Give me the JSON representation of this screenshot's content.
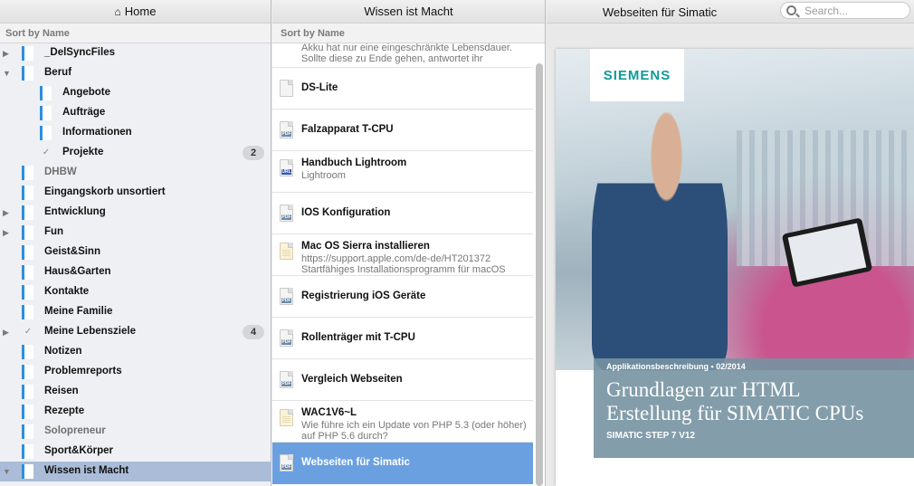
{
  "left": {
    "header": "Home",
    "sort": "Sort by Name",
    "items": [
      {
        "label": "_DelSyncFiles",
        "indent": 0,
        "disclosure": "right",
        "dim": false,
        "badge": "",
        "check": false,
        "selected": false
      },
      {
        "label": "Beruf",
        "indent": 0,
        "disclosure": "down",
        "dim": false,
        "badge": "",
        "check": false,
        "selected": false
      },
      {
        "label": "Angebote",
        "indent": 1,
        "disclosure": "",
        "dim": false,
        "badge": "",
        "check": false,
        "selected": false
      },
      {
        "label": "Aufträge",
        "indent": 1,
        "disclosure": "",
        "dim": false,
        "badge": "",
        "check": false,
        "selected": false
      },
      {
        "label": "Informationen",
        "indent": 1,
        "disclosure": "",
        "dim": false,
        "badge": "",
        "check": false,
        "selected": false
      },
      {
        "label": "Projekte",
        "indent": 1,
        "disclosure": "",
        "dim": false,
        "badge": "2",
        "check": true,
        "selected": false
      },
      {
        "label": "DHBW",
        "indent": 0,
        "disclosure": "",
        "dim": true,
        "badge": "",
        "check": false,
        "selected": false
      },
      {
        "label": "Eingangskorb unsortiert",
        "indent": 0,
        "disclosure": "",
        "dim": false,
        "badge": "",
        "check": false,
        "selected": false
      },
      {
        "label": "Entwicklung",
        "indent": 0,
        "disclosure": "right",
        "dim": false,
        "badge": "",
        "check": false,
        "selected": false
      },
      {
        "label": "Fun",
        "indent": 0,
        "disclosure": "right",
        "dim": false,
        "badge": "",
        "check": false,
        "selected": false
      },
      {
        "label": "Geist&Sinn",
        "indent": 0,
        "disclosure": "",
        "dim": false,
        "badge": "",
        "check": false,
        "selected": false
      },
      {
        "label": "Haus&Garten",
        "indent": 0,
        "disclosure": "",
        "dim": false,
        "badge": "",
        "check": false,
        "selected": false
      },
      {
        "label": "Kontakte",
        "indent": 0,
        "disclosure": "",
        "dim": false,
        "badge": "",
        "check": false,
        "selected": false
      },
      {
        "label": "Meine Familie",
        "indent": 0,
        "disclosure": "",
        "dim": false,
        "badge": "",
        "check": false,
        "selected": false
      },
      {
        "label": "Meine Lebensziele",
        "indent": 0,
        "disclosure": "right",
        "dim": false,
        "badge": "4",
        "check": true,
        "selected": false
      },
      {
        "label": "Notizen",
        "indent": 0,
        "disclosure": "",
        "dim": false,
        "badge": "",
        "check": false,
        "selected": false
      },
      {
        "label": "Problemreports",
        "indent": 0,
        "disclosure": "",
        "dim": false,
        "badge": "",
        "check": false,
        "selected": false
      },
      {
        "label": "Reisen",
        "indent": 0,
        "disclosure": "",
        "dim": false,
        "badge": "",
        "check": false,
        "selected": false
      },
      {
        "label": "Rezepte",
        "indent": 0,
        "disclosure": "",
        "dim": false,
        "badge": "",
        "check": false,
        "selected": false
      },
      {
        "label": "Solopreneur",
        "indent": 0,
        "disclosure": "",
        "dim": true,
        "badge": "",
        "check": false,
        "selected": false
      },
      {
        "label": "Sport&Körper",
        "indent": 0,
        "disclosure": "",
        "dim": false,
        "badge": "",
        "check": false,
        "selected": false
      },
      {
        "label": "Wissen ist Macht",
        "indent": 0,
        "disclosure": "down",
        "dim": false,
        "badge": "",
        "check": false,
        "selected": true
      }
    ]
  },
  "middle": {
    "header": "Wissen ist Macht",
    "sort": "Sort by Name",
    "items": [
      {
        "title": "",
        "sub": [
          "Akku hat nur eine eingeschränkte Lebensdauer.",
          "Sollte diese zu Ende gehen, antwortet ihr"
        ],
        "icon": "none",
        "tag": "",
        "partial": true,
        "selected": false
      },
      {
        "title": "DS-Lite",
        "sub": [],
        "icon": "doc",
        "tag": "",
        "partial": false,
        "selected": false
      },
      {
        "title": "Falzapparat T-CPU",
        "sub": [],
        "icon": "doc",
        "tag": "PDF",
        "partial": false,
        "selected": false
      },
      {
        "title": "Handbuch Lightroom",
        "sub": [
          "Lightroom"
        ],
        "icon": "doc",
        "tag": "URL",
        "partial": false,
        "selected": false
      },
      {
        "title": "IOS Konfiguration",
        "sub": [],
        "icon": "doc",
        "tag": "PDF",
        "partial": false,
        "selected": false
      },
      {
        "title": "Mac OS Sierra installieren",
        "sub": [
          "https://support.apple.com/de-de/HT201372",
          "Startfähiges Installationsprogramm für macOS"
        ],
        "icon": "note",
        "tag": "",
        "partial": false,
        "selected": false
      },
      {
        "title": "Registrierung iOS Geräte",
        "sub": [],
        "icon": "doc",
        "tag": "PDF",
        "partial": false,
        "selected": false
      },
      {
        "title": "Rollenträger mit T-CPU",
        "sub": [],
        "icon": "doc",
        "tag": "PDF",
        "partial": false,
        "selected": false
      },
      {
        "title": "Vergleich Webseiten",
        "sub": [],
        "icon": "doc",
        "tag": "PDF",
        "partial": false,
        "selected": false
      },
      {
        "title": "WAC1V6~L",
        "sub": [
          "Wie führe ich ein Update von PHP 5.3 (oder höher)",
          "auf PHP 5.6 durch?"
        ],
        "icon": "note",
        "tag": "",
        "partial": false,
        "selected": false
      },
      {
        "title": "Webseiten für Simatic",
        "sub": [],
        "icon": "doc",
        "tag": "PDF",
        "partial": false,
        "selected": true
      }
    ]
  },
  "right": {
    "header": "Webseiten für Simatic",
    "search_placeholder": "Search...",
    "document": {
      "logo": "SIEMENS",
      "label": "Applikationsbeschreibung • 02/2014",
      "title_line1": "Grundlagen zur HTML",
      "title_line2": "Erstellung für SIMATIC CPUs",
      "subtitle": "SIMATIC STEP 7 V12"
    }
  },
  "colors": {
    "folder_accent": "#2b8fe0",
    "selected_row": "#aabcd8",
    "selected_item": "#6aa0e0",
    "siemens_teal": "#0f9a99"
  }
}
